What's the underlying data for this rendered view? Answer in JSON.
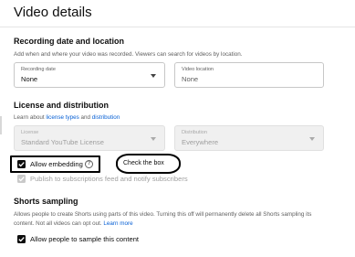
{
  "page": {
    "title": "Video details"
  },
  "recording": {
    "title": "Recording date and location",
    "helper": "Add when and where your video was recorded. Viewers can search for videos by location.",
    "date_label": "Recording date",
    "date_value": "None",
    "location_label": "Video location",
    "location_placeholder": "None"
  },
  "license": {
    "title": "License and distribution",
    "helper_prefix": "Learn about",
    "helper_link1": "license types",
    "helper_and": "and",
    "helper_link2": "distribution",
    "license_label": "License",
    "license_value": "Standard YouTube License",
    "distribution_label": "Distribution",
    "distribution_value": "Everywhere",
    "allow_embedding_label": "Allow embedding",
    "allow_embedding_checked": true,
    "publish_label": "Publish to subscriptions feed and notify subscribers",
    "publish_checked": true,
    "help_glyph": "?"
  },
  "annotation": {
    "callout_text": "Check the box"
  },
  "shorts": {
    "title": "Shorts sampling",
    "helper_line1": "Allows people to create Shorts using parts of this video. Turning this off will permanently delete all Shorts sampling its",
    "helper_line2": "content. Not all videos can opt out.",
    "learn_more": "Learn more",
    "allow_sampling_label": "Allow people to sample this content",
    "allow_sampling_checked": true
  },
  "icons": {
    "dropdown": "chevron-down-icon",
    "checkmark": "checkmark-icon",
    "help": "help-circle-icon"
  },
  "colors": {
    "link": "#065fd4",
    "text": "#0d0d0d",
    "muted": "#606060"
  }
}
